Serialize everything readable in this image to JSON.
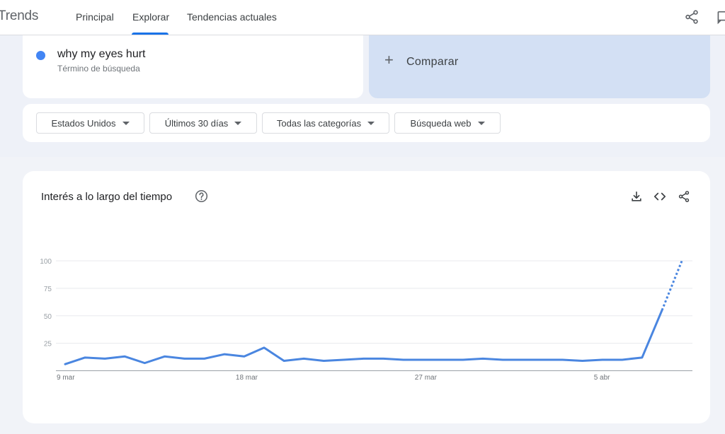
{
  "header": {
    "brand": "Trends",
    "tabs": [
      {
        "label": "Principal"
      },
      {
        "label": "Explorar"
      },
      {
        "label": "Tendencias actuales"
      }
    ],
    "active_tab": "Explorar"
  },
  "search_term": {
    "text": "why my eyes hurt",
    "subtitle": "Término de búsqueda",
    "color": "#4285f4"
  },
  "compare": {
    "label": "Comparar"
  },
  "filters": [
    {
      "label": "Estados Unidos"
    },
    {
      "label": "Últimos 30 días"
    },
    {
      "label": "Todas las categorías"
    },
    {
      "label": "Búsqueda web"
    }
  ],
  "chart_card": {
    "title": "Interés a lo largo del tiempo"
  },
  "chart_data": {
    "type": "line",
    "title": "Interés a lo largo del tiempo",
    "xlabel": "",
    "ylabel": "",
    "ylim": [
      0,
      100
    ],
    "yticks": [
      25,
      50,
      75,
      100
    ],
    "xtick_labels": [
      {
        "label": "9 mar",
        "index": 0
      },
      {
        "label": "18 mar",
        "index": 9
      },
      {
        "label": "27 mar",
        "index": 18
      },
      {
        "label": "5 abr",
        "index": 27
      }
    ],
    "dates": [
      "9 mar",
      "10 mar",
      "11 mar",
      "12 mar",
      "13 mar",
      "14 mar",
      "15 mar",
      "16 mar",
      "17 mar",
      "18 mar",
      "19 mar",
      "20 mar",
      "21 mar",
      "22 mar",
      "23 mar",
      "24 mar",
      "25 mar",
      "26 mar",
      "27 mar",
      "28 mar",
      "29 mar",
      "30 mar",
      "31 mar",
      "1 abr",
      "2 abr",
      "3 abr",
      "4 abr",
      "5 abr",
      "6 abr",
      "7 abr",
      "8 abr",
      "9 abr",
      "10 abr"
    ],
    "series": [
      {
        "color": "#4a86e0",
        "values": [
          6,
          12,
          11,
          13,
          7,
          13,
          11,
          11,
          15,
          13,
          21,
          9,
          11,
          9,
          10,
          11,
          11,
          10,
          10,
          10,
          10,
          11,
          10,
          10,
          10,
          10,
          9,
          10,
          10,
          12,
          55,
          100
        ],
        "partial_from_index": 30
      }
    ],
    "grid": true
  }
}
